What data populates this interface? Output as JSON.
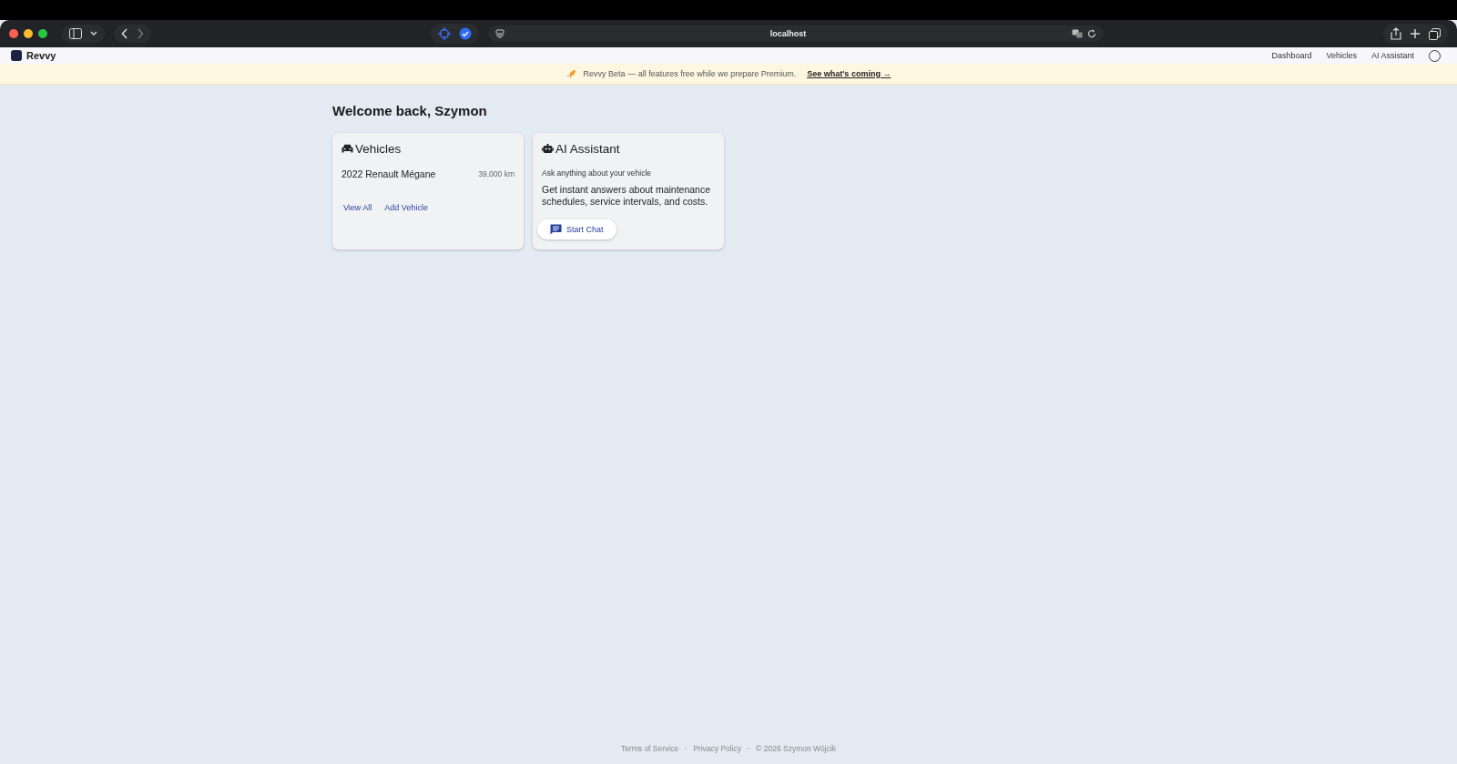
{
  "browser": {
    "url": "localhost"
  },
  "app_header": {
    "logo": "Revvy",
    "nav": [
      {
        "label": "Dashboard"
      },
      {
        "label": "Vehicles"
      },
      {
        "label": "AI Assistant"
      }
    ]
  },
  "banner": {
    "text": "Revvy Beta — all features free while we prepare Premium.",
    "link": "See what's coming →"
  },
  "heading": "Welcome back, Szymon",
  "vehicles_card": {
    "title": "Vehicles",
    "vehicles": [
      {
        "name": "2022 Renault Mégane",
        "mileage": "39,000 km"
      }
    ],
    "links": [
      "View All",
      "Add Vehicle"
    ]
  },
  "assistant_card": {
    "title": "AI Assistant",
    "subtitle": "Ask anything about your vehicle",
    "description": "Get instant answers about maintenance schedules, service intervals, and costs.",
    "button": "Start Chat"
  },
  "footer": {
    "links": [
      "Terms of Service",
      "Privacy Policy"
    ],
    "copyright": "© 2026 Szymon Wójcik"
  }
}
